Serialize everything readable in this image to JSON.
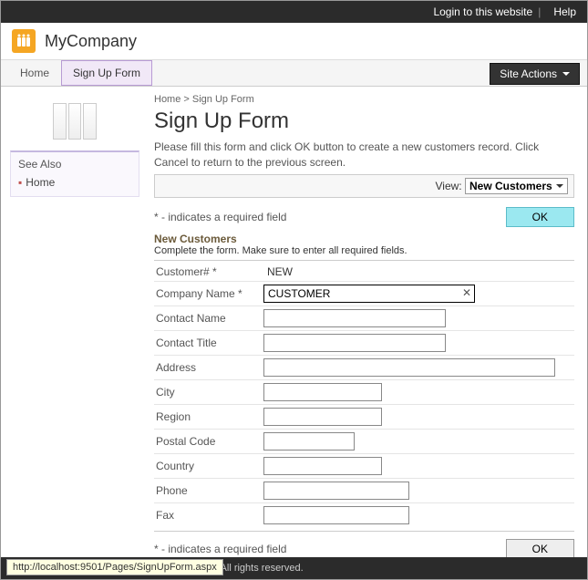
{
  "topbar": {
    "login": "Login to this website",
    "help": "Help"
  },
  "brand": {
    "company": "MyCompany"
  },
  "nav": {
    "tabs": [
      "Home",
      "Sign Up Form"
    ],
    "siteActions": "Site Actions"
  },
  "sidebar": {
    "seeAlsoTitle": "See Also",
    "items": [
      "Home"
    ]
  },
  "breadcrumb": {
    "home": "Home",
    "sep": ">",
    "current": "Sign Up Form"
  },
  "page": {
    "title": "Sign Up Form",
    "desc": "Please fill this form and click OK button to create a new customers record. Click Cancel to return to the previous screen.",
    "viewLabel": "View:",
    "viewValue": "New Customers",
    "requiredNote": "* - indicates a required field",
    "okLabel": "OK",
    "sectionTitle": "New Customers",
    "sectionSub": "Complete the form. Make sure to enter all required fields."
  },
  "form": {
    "customerIdLabel": "Customer#",
    "customerIdReq": "*",
    "customerIdValue": "NEW",
    "companyNameLabel": "Company Name",
    "companyNameReq": "*",
    "companyNameValue": "CUSTOMER",
    "contactNameLabel": "Contact Name",
    "contactNameValue": "",
    "contactTitleLabel": "Contact Title",
    "contactTitleValue": "",
    "addressLabel": "Address",
    "addressValue": "",
    "cityLabel": "City",
    "cityValue": "",
    "regionLabel": "Region",
    "regionValue": "",
    "postalCodeLabel": "Postal Code",
    "postalCodeValue": "",
    "countryLabel": "Country",
    "countryValue": "",
    "phoneLabel": "Phone",
    "phoneValue": "",
    "faxLabel": "Fax",
    "faxValue": ""
  },
  "footer": {
    "copyright": "y. All rights reserved."
  },
  "status": {
    "url": "http://localhost:9501/Pages/SignUpForm.aspx"
  }
}
